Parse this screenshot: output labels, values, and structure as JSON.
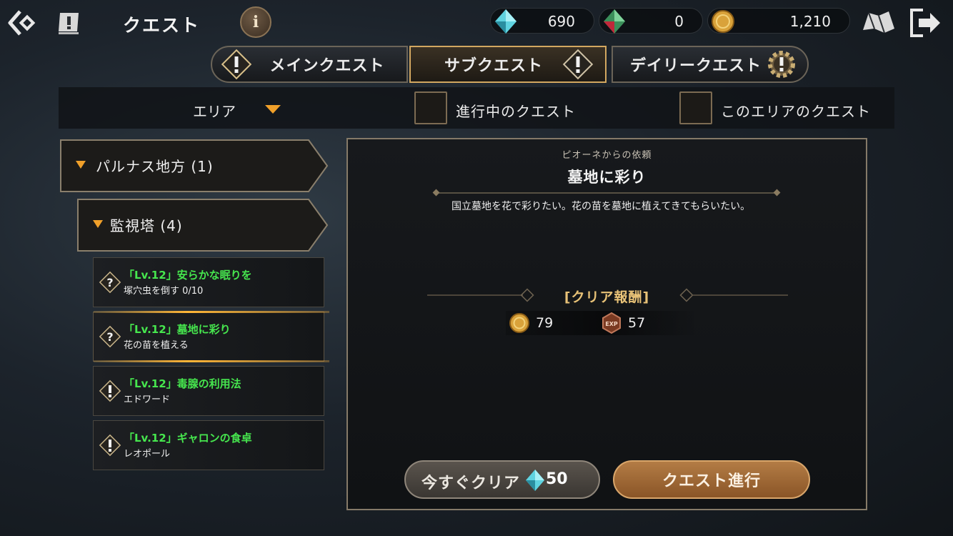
{
  "header": {
    "title": "クエスト",
    "info_label": "i",
    "currencies": [
      {
        "icon": "diamond-gem-icon",
        "value": "690"
      },
      {
        "icon": "red-crystal-icon",
        "value": "0"
      },
      {
        "icon": "gold-coin-icon",
        "value": "1,210"
      }
    ]
  },
  "tabs": [
    {
      "label": "メインクエスト",
      "icon": "exclamation-diamond-icon",
      "active": false
    },
    {
      "label": "サブクエスト",
      "icon": "exclamation-diamond-icon",
      "active": true
    },
    {
      "label": "デイリークエスト",
      "icon": "gear-exclamation-icon",
      "active": false
    }
  ],
  "filters": {
    "area_label": "エリア",
    "in_progress_label": "進行中のクエスト",
    "this_area_label": "このエリアのクエスト"
  },
  "quest_list": {
    "region": "パルナス地方 (1)",
    "subregion": "監視塔 (4)",
    "items": [
      {
        "title": "「Lv.12」安らかな眠りを",
        "subtitle": "塚穴虫を倒す 0/10",
        "icon": "question-diamond-icon",
        "selected": false
      },
      {
        "title": "「Lv.12」墓地に彩り",
        "subtitle": "花の苗を植える",
        "icon": "question-diamond-icon",
        "selected": true
      },
      {
        "title": "「Lv.12」毒腺の利用法",
        "subtitle": "エドワード",
        "icon": "exclamation-diamond-icon",
        "selected": false
      },
      {
        "title": "「Lv.12」ギャロンの食卓",
        "subtitle": "レオポール",
        "icon": "exclamation-diamond-icon",
        "selected": false
      }
    ]
  },
  "detail": {
    "client": "ピオーネからの依頼",
    "name": "墓地に彩り",
    "description": "国立墓地を花で彩りたい。花の苗を墓地に植えてきてもらいたい。",
    "reward_title": "[クリア報酬]",
    "rewards": [
      {
        "icon": "gold-coin-icon",
        "value": "79"
      },
      {
        "icon": "exp-badge-icon",
        "value": "57"
      }
    ],
    "instant_clear_label": "今すぐクリア",
    "instant_clear_cost": "50",
    "proceed_label": "クエスト進行"
  },
  "colors": {
    "accent_gold": "#e8c277",
    "quest_title_green": "#46e64e",
    "selected_glow": "#ffb637"
  }
}
